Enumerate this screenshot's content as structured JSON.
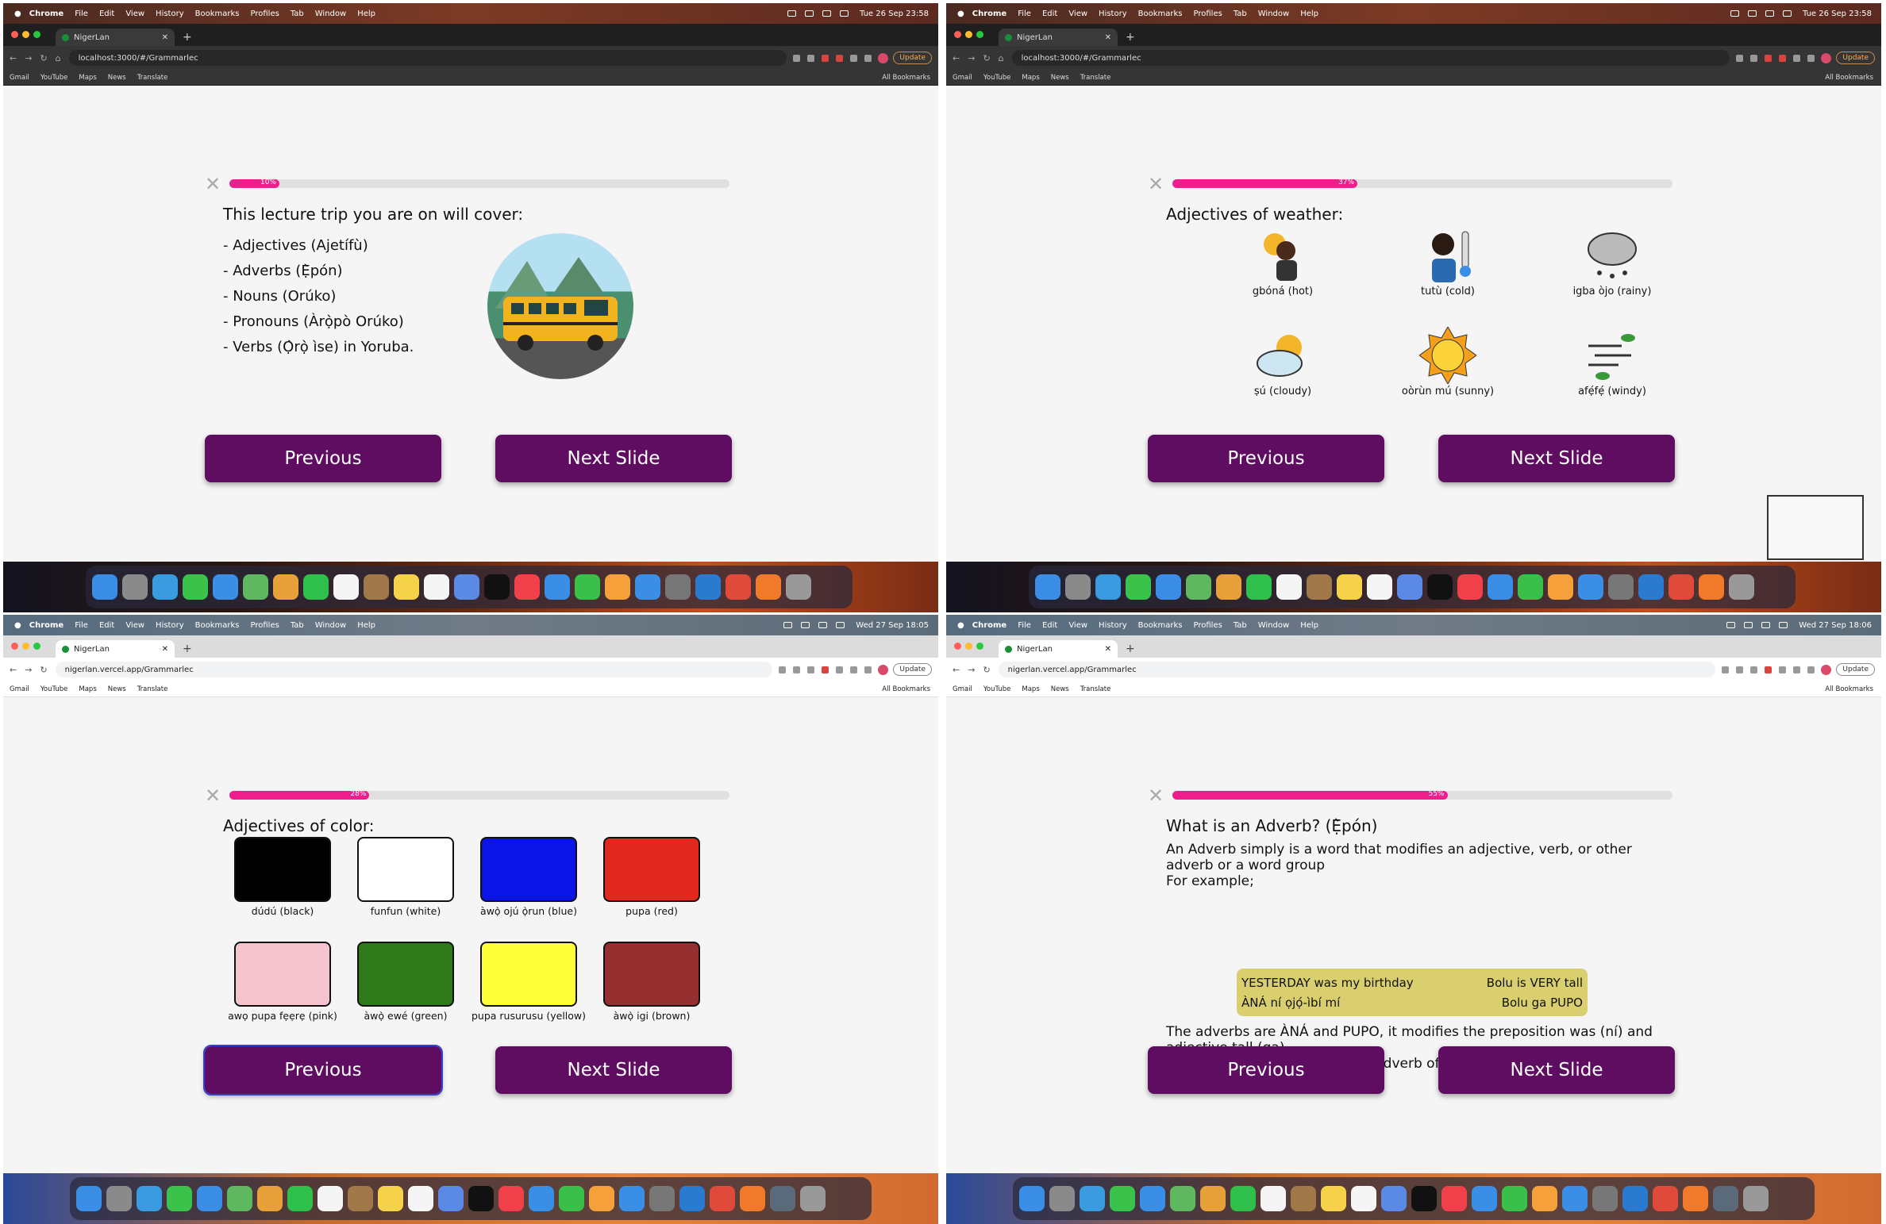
{
  "os_menu": {
    "app": "Chrome",
    "items": [
      "File",
      "Edit",
      "View",
      "History",
      "Bookmarks",
      "Profiles",
      "Tab",
      "Window",
      "Help"
    ]
  },
  "bookmarks": [
    "Gmail",
    "YouTube",
    "Maps",
    "News",
    "Translate"
  ],
  "all_bookmarks": "All Bookmarks",
  "update_label": "Update",
  "tab_title": "NigerLan",
  "buttons": {
    "previous": "Previous",
    "next": "Next Slide"
  },
  "panels": [
    {
      "clock": "Tue 26 Sep 23:58",
      "url": "localhost:3000/#/Grammarlec",
      "progress": {
        "percent": 10,
        "label": "10%"
      },
      "heading": "This lecture trip you are on will cover:",
      "topics": [
        "- Adjectives (Ajetífù)",
        "- Adverbs (Ẹ̀pón)",
        "- Nouns (Orúko)",
        "- Pronouns (Àrọ̀pò Orúko)",
        "- Verbs (Ọ̀rọ̀ ìse) in Yoruba."
      ]
    },
    {
      "clock": "Tue 26 Sep 23:58",
      "url": "localhost:3000/#/Grammarlec",
      "progress": {
        "percent": 37,
        "label": "37%"
      },
      "heading": "Adjectives of weather:",
      "weather": [
        {
          "label": "gbóná (hot)",
          "icon": "hot-person-icon"
        },
        {
          "label": "tutù (cold)",
          "icon": "cold-thermometer-icon"
        },
        {
          "label": "igba òjo (rainy)",
          "icon": "rain-cloud-icon"
        },
        {
          "label": "ṣú (cloudy)",
          "icon": "cloud-sun-icon"
        },
        {
          "label": "oòrùn mú (sunny)",
          "icon": "sun-icon"
        },
        {
          "label": "afẹ́fẹ́ (windy)",
          "icon": "wind-leaves-icon"
        }
      ]
    },
    {
      "clock": "Wed 27 Sep 18:05",
      "url": "nigerlan.vercel.app/Grammarlec",
      "progress": {
        "percent": 28,
        "label": "28%"
      },
      "heading": "Adjectives of color:",
      "colors": [
        {
          "label": "dúdú (black)",
          "hex": "#000000"
        },
        {
          "label": "funfun (white)",
          "hex": "#ffffff"
        },
        {
          "label": "àwọ̀ ojú ọ̀run (blue)",
          "hex": "#0a14e6"
        },
        {
          "label": "pupa (red)",
          "hex": "#e0281e"
        },
        {
          "label": "awọ pupa fẹẹrẹ (pink)",
          "hex": "#f5c4cf"
        },
        {
          "label": "àwọ̀ ewé (green)",
          "hex": "#2e7a1a"
        },
        {
          "label": "pupa rusurusu (yellow)",
          "hex": "#ffff3a"
        },
        {
          "label": "àwọ̀ igi (brown)",
          "hex": "#963030"
        }
      ]
    },
    {
      "clock": "Wed 27 Sep 18:06",
      "url": "nigerlan.vercel.app/Grammarlec",
      "progress": {
        "percent": 55,
        "label": "55%"
      },
      "heading": "What is an Adverb? (Ẹ̀pón)",
      "definition": "An Adverb simply is a word that modifies an adjective, verb, or other adverb or a word group",
      "for_example": "For example;",
      "examples": [
        [
          "YESTERDAY was my birthday",
          "Bolu is VERY tall"
        ],
        [
          "ÀNÁ ní ọjọ́-ìbí mí",
          "Bolu ga PUPO"
        ]
      ],
      "explanation": "The adverbs are ÀNÁ and PUPO, it modifies the preposition was (ní) and adjective tall (ga)",
      "closing": "On our trip we will be learning Adverb of time, manner and place"
    }
  ],
  "colors": {
    "button": "#5e0d60",
    "progress": "#ee1e8c"
  }
}
